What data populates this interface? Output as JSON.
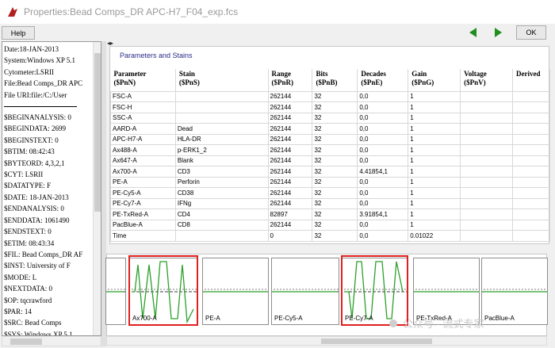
{
  "window": {
    "title": "Properties:Bead Comps_DR APC-H7_F04_exp.fcs",
    "icon": "app-icon"
  },
  "toolbar": {
    "help_label": "Help",
    "ok_label": "OK",
    "back_icon": "arrow-left-icon",
    "forward_icon": "arrow-right-icon"
  },
  "keywords": [
    "Date:18-JAN-2013",
    "System:Windows XP 5.1",
    "Cytometer:LSRII",
    "File:Bead Comps_DR APC",
    "File URI:file:/C:/User",
    "$BEGINANALYSIS: 0",
    "$BEGINDATA: 2699",
    "$BEGINSTEXT: 0",
    "$BTIM: 08:42:43",
    "$BYTEORD: 4,3,2,1",
    "$CYT: LSRII",
    "$DATATYPE: F",
    "$DATE: 18-JAN-2013",
    "$ENDANALYSIS: 0",
    "$ENDDATA: 1061490",
    "$ENDSTEXT: 0",
    "$ETIM: 08:43:34",
    "$FIL: Bead Comps_DR AF",
    "$INST: University of F",
    "$MODE: L",
    "$NEXTDATA: 0",
    "$OP: tqcrawford",
    "$PAR: 14",
    "$SRC: Bead Comps",
    "$SYS: Windows XP 5.1"
  ],
  "group_label": "Parameters and Stains",
  "columns": [
    {
      "name": "Parameter",
      "code": "($PnN)"
    },
    {
      "name": "Stain",
      "code": "($PnS)"
    },
    {
      "name": "Range",
      "code": "($PnR)"
    },
    {
      "name": "Bits",
      "code": "($PnB)"
    },
    {
      "name": "Decades",
      "code": "($PnE)"
    },
    {
      "name": "Gain",
      "code": "($PnG)"
    },
    {
      "name": "Voltage",
      "code": "($PnV)"
    },
    {
      "name": "Derived",
      "code": ""
    }
  ],
  "rows": [
    [
      "FSC-A",
      "",
      "262144",
      "32",
      "0,0",
      "1"
    ],
    [
      "FSC-H",
      "",
      "262144",
      "32",
      "0,0",
      "1"
    ],
    [
      "SSC-A",
      "",
      "262144",
      "32",
      "0,0",
      "1"
    ],
    [
      "AARD-A",
      "Dead",
      "262144",
      "32",
      "0,0",
      "1"
    ],
    [
      "APC-H7-A",
      "HLA-DR",
      "262144",
      "32",
      "0,0",
      "1"
    ],
    [
      "Ax488-A",
      "p-ERK1_2",
      "262144",
      "32",
      "0,0",
      "1"
    ],
    [
      "Ax647-A",
      "Blank",
      "262144",
      "32",
      "0,0",
      "1"
    ],
    [
      "Ax700-A",
      "CD3",
      "262144",
      "32",
      "4.41854,1",
      "1"
    ],
    [
      "PE-A",
      "Perforin",
      "262144",
      "32",
      "0,0",
      "1"
    ],
    [
      "PE-Cy5-A",
      "CD38",
      "262144",
      "32",
      "0,0",
      "1"
    ],
    [
      "PE-Cy7-A",
      "IFNg",
      "262144",
      "32",
      "0,0",
      "1"
    ],
    [
      "PE-TxRed-A",
      "CD4",
      "82897",
      "32",
      "3.91854,1",
      "1"
    ],
    [
      "PacBlue-A",
      "CD8",
      "262144",
      "32",
      "0,0",
      "1"
    ],
    [
      "Time",
      "",
      "0",
      "32",
      "0,0",
      "0.01022"
    ]
  ],
  "plots": [
    "",
    "Ax700-A",
    "PE-A",
    "PE-Cy5-A",
    "PE-Cy7-A",
    "PE-TxRed-A",
    "PacBlue-A"
  ],
  "watermark": "公众号 · 流式专家",
  "colors": {
    "trace": "#2aa02a",
    "highlight": "#e02020",
    "arrow": "#1f8f1f"
  }
}
